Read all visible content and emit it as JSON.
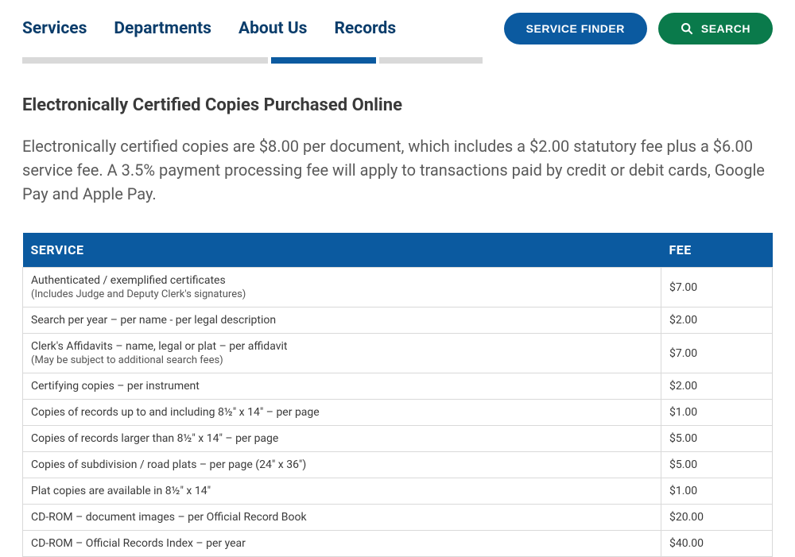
{
  "nav": {
    "links": [
      "Services",
      "Departments",
      "About Us",
      "Records"
    ],
    "finder_label": "SERVICE FINDER",
    "search_label": "SEARCH"
  },
  "page": {
    "title": "Electronically Certified Copies Purchased Online",
    "description": "Electronically certified copies are $8.00 per document, which includes a $2.00 statutory fee plus a $6.00 service fee. A 3.5% payment processing fee will apply to transactions paid by credit or debit cards, Google Pay and Apple Pay."
  },
  "table": {
    "headers": {
      "service": "SERVICE",
      "fee": "FEE"
    },
    "rows": [
      {
        "service": "Authenticated / exemplified certificates",
        "sub": "(Includes Judge and Deputy Clerk's signatures)",
        "fee": "$7.00"
      },
      {
        "service": "Search per year – per name - per legal description",
        "sub": "",
        "fee": "$2.00"
      },
      {
        "service": "Clerk's Affidavits – name, legal or plat – per affidavit",
        "sub": "(May be subject to additional search fees)",
        "fee": "$7.00"
      },
      {
        "service": "Certifying copies – per instrument",
        "sub": "",
        "fee": "$2.00"
      },
      {
        "service": "Copies of records up to and including 8½\" x 14\" – per page",
        "sub": "",
        "fee": "$1.00"
      },
      {
        "service": "Copies of records larger than 8½\" x 14\" – per page",
        "sub": "",
        "fee": "$5.00"
      },
      {
        "service": "Copies of subdivision / road plats – per page (24\" x 36\")",
        "sub": "",
        "fee": "$5.00"
      },
      {
        "service": "Plat copies are available in 8½\" x 14\"",
        "sub": "",
        "fee": "$1.00"
      },
      {
        "service": "CD-ROM – document images – per Official Record Book",
        "sub": "",
        "fee": "$20.00"
      },
      {
        "service": "CD-ROM – Official Records Index – per year",
        "sub": "",
        "fee": "$40.00"
      }
    ]
  }
}
